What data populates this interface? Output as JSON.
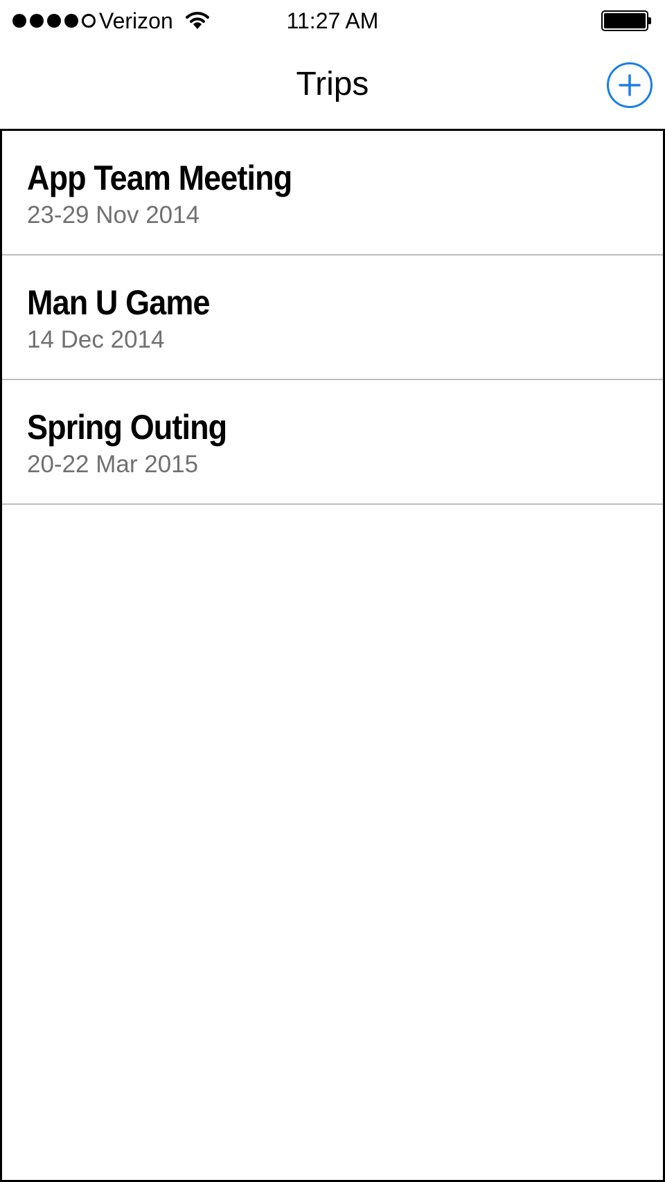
{
  "status_bar": {
    "signal_bars_filled": 4,
    "signal_bars_total": 5,
    "carrier": "Verizon",
    "wifi_icon": "wifi-icon",
    "time": "11:27 AM",
    "battery_icon": "battery-icon",
    "battery_level": 1.0
  },
  "nav": {
    "title": "Trips",
    "add_icon": "plus-circle-icon",
    "accent_color": "#1a7ee6"
  },
  "trips": [
    {
      "name": "App Team Meeting",
      "dates": "23-29 Nov 2014"
    },
    {
      "name": "Man U Game",
      "dates": "14 Dec 2014"
    },
    {
      "name": "Spring Outing",
      "dates": "20-22 Mar 2015"
    }
  ]
}
